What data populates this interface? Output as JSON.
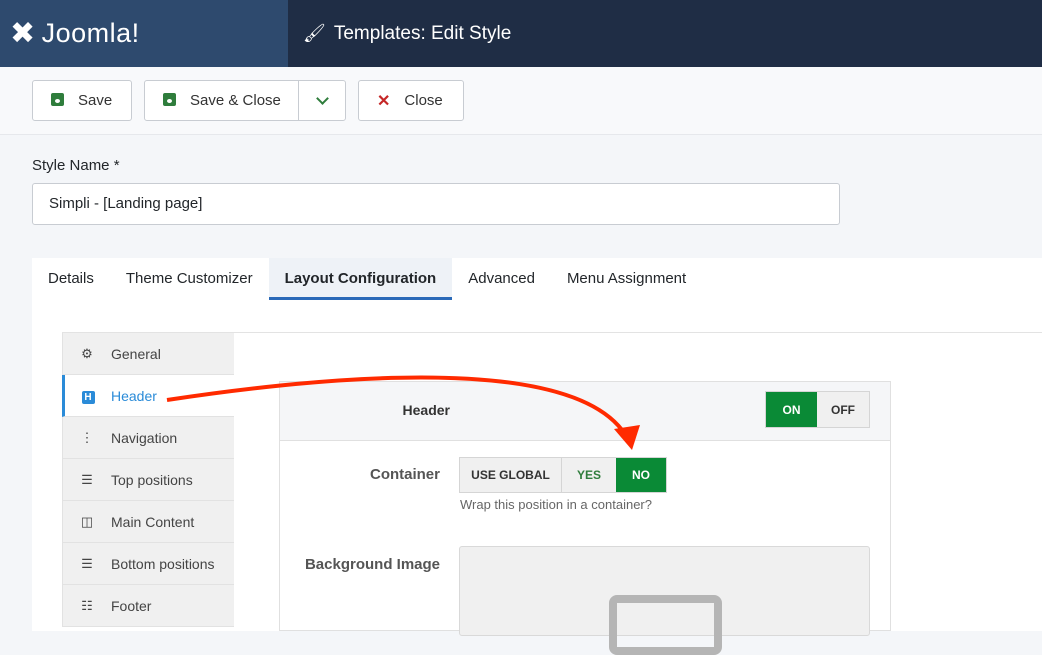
{
  "header": {
    "logo": "Joomla!",
    "title": "Templates: Edit Style"
  },
  "toolbar": {
    "save": "Save",
    "save_close": "Save & Close",
    "close": "Close"
  },
  "form": {
    "style_name_label": "Style Name *",
    "style_name_value": "Simpli - [Landing page]"
  },
  "tabs": [
    {
      "label": "Details"
    },
    {
      "label": "Theme Customizer"
    },
    {
      "label": "Layout Configuration",
      "active": true
    },
    {
      "label": "Advanced"
    },
    {
      "label": "Menu Assignment"
    }
  ],
  "sidebar": [
    {
      "label": "General",
      "icon": "gear-icon"
    },
    {
      "label": "Header",
      "icon": "h-square-icon",
      "active": true
    },
    {
      "label": "Navigation",
      "icon": "ellipsis-vertical-icon"
    },
    {
      "label": "Top positions",
      "icon": "bars-icon"
    },
    {
      "label": "Main Content",
      "icon": "columns-icon"
    },
    {
      "label": "Bottom positions",
      "icon": "bars-icon"
    },
    {
      "label": "Footer",
      "icon": "sliders-icon"
    }
  ],
  "panel": {
    "title": "Header",
    "toggle": {
      "on": "ON",
      "off": "OFF",
      "value": "ON"
    },
    "container": {
      "label": "Container",
      "options": [
        "USE GLOBAL",
        "YES",
        "NO"
      ],
      "value": "NO",
      "help": "Wrap this position in a container?"
    },
    "background_label": "Background Image"
  },
  "colors": {
    "accent": "#0a8a36",
    "annotation": "#ff2a00",
    "link": "#2a8bd8"
  }
}
